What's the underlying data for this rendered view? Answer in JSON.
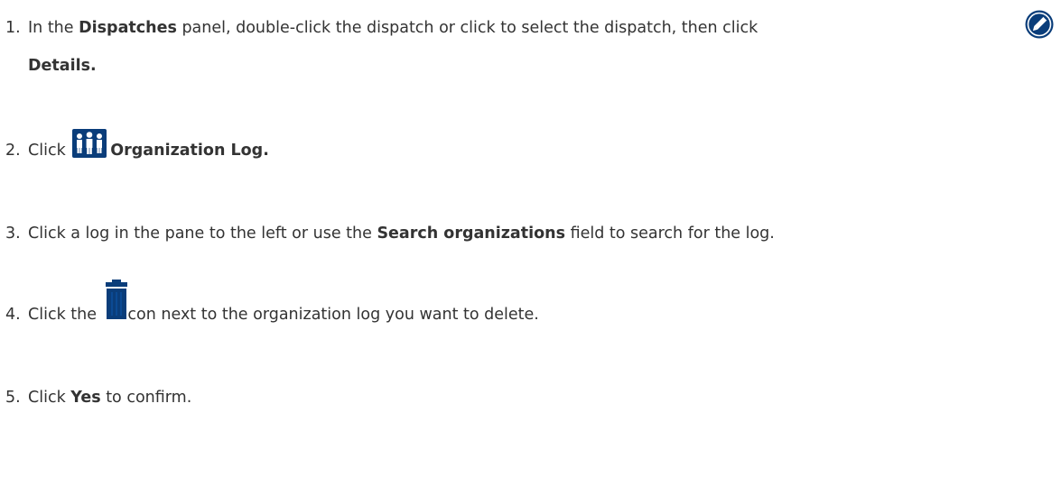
{
  "steps": [
    {
      "number": "1.",
      "t1": "In the ",
      "b1": "Dispatches",
      "t2": " panel, double-click the dispatch or click to select the dispatch, then click",
      "b2": "Details.",
      "icon": "pencil-edit-icon"
    },
    {
      "number": "2.",
      "t1": "Click ",
      "b1": "Organization Log.",
      "icon": "organization-people-icon"
    },
    {
      "number": "3.",
      "t1": "Click a log in the pane to the left or use the ",
      "b1": "Search organizations",
      "t2": " field to search for the log."
    },
    {
      "number": "4.",
      "t1": "Click the ",
      "t2": "icon next to the organization log you want to delete.",
      "icon": "trash-delete-icon"
    },
    {
      "number": "5.",
      "t1": "Click ",
      "b1": "Yes",
      "t2": " to confirm."
    }
  ],
  "colors": {
    "text": "#333333",
    "icon_blue": "#0a3d7a"
  }
}
